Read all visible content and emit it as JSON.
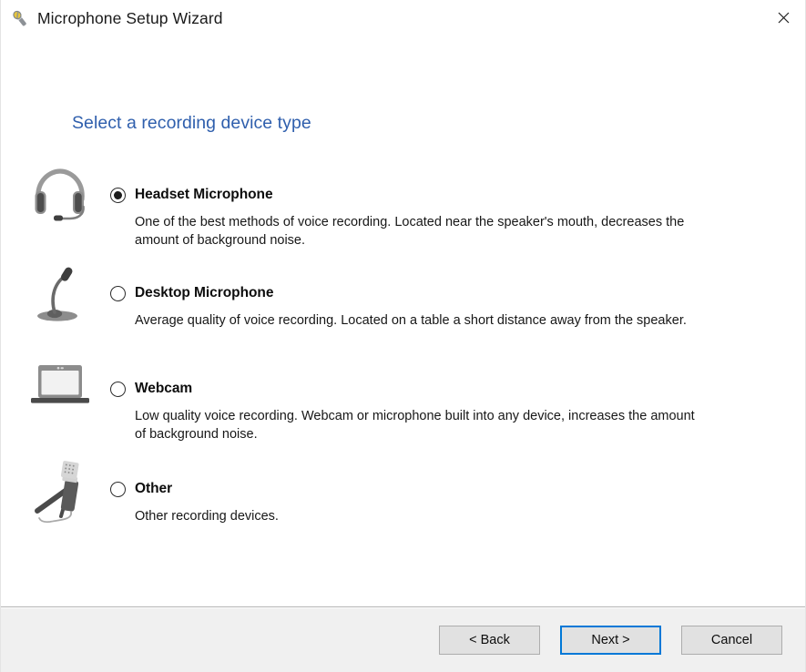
{
  "window": {
    "title": "Microphone Setup Wizard",
    "title_icon": "microphone-icon",
    "close_label": "✕"
  },
  "page": {
    "heading": "Select a recording device type",
    "heading_color": "#2f5fad"
  },
  "options": [
    {
      "id": "headset",
      "icon": "headset-icon",
      "title": "Headset Microphone",
      "description": "One of the best methods of voice recording. Located near the speaker's mouth, decreases the amount of background noise.",
      "selected": true
    },
    {
      "id": "desktop",
      "icon": "desktop-microphone-icon",
      "title": "Desktop Microphone",
      "description": "Average quality of voice recording. Located on a table a short distance away from the speaker.",
      "selected": false
    },
    {
      "id": "webcam",
      "icon": "laptop-webcam-icon",
      "title": "Webcam",
      "description": "Low quality voice recording. Webcam or microphone built into any device, increases the amount of background noise.",
      "selected": false
    },
    {
      "id": "other",
      "icon": "studio-microphone-icon",
      "title": "Other",
      "description": "Other recording devices.",
      "selected": false
    }
  ],
  "footer": {
    "back_label": "< Back",
    "next_label": "Next >",
    "cancel_label": "Cancel",
    "default_button": "next",
    "focus_color": "#0078d7"
  }
}
